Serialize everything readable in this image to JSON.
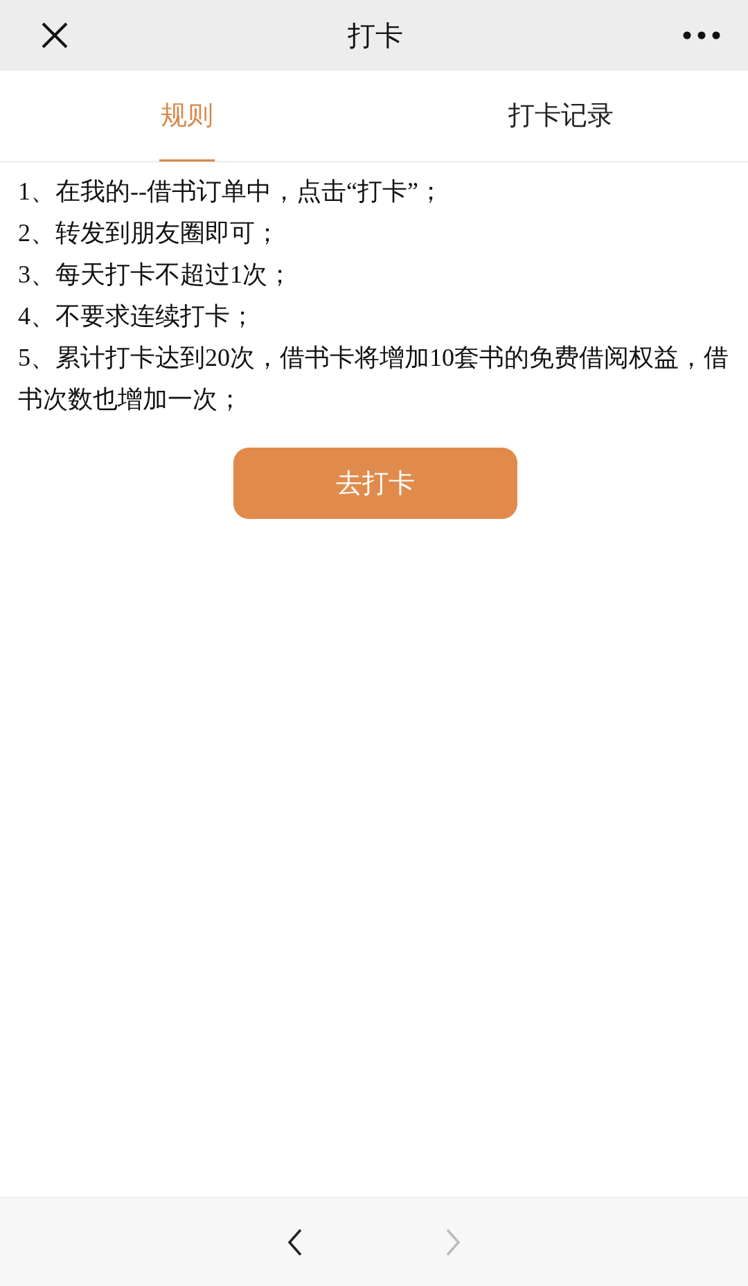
{
  "window": {
    "title": "打卡"
  },
  "tabs": [
    {
      "label": "规则",
      "selected": true
    },
    {
      "label": "打卡记录",
      "selected": false
    }
  ],
  "rules": [
    "1、在我的--借书订单中，点击“打卡”；",
    "2、转发到朋友圈即可；",
    "3、每天打卡不超过1次；",
    "4、不要求连续打卡；",
    "5、累计打卡达到20次，借书卡将增加10套书的免费借阅权益，借书次数也增加一次；"
  ],
  "action_button": {
    "label": "去打卡"
  },
  "nav": {
    "back_disabled": false,
    "forward_disabled": true
  }
}
